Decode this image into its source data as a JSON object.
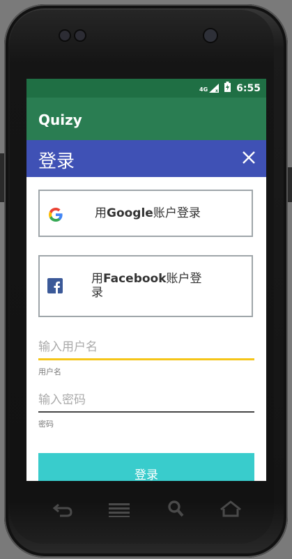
{
  "status": {
    "network": "4G",
    "time": "6:55"
  },
  "app": {
    "title": "Quizy"
  },
  "dialog": {
    "title": "登录",
    "google_prefix": "用",
    "google_brand": "Google",
    "google_suffix": "账户登录",
    "facebook_prefix": "用",
    "facebook_brand": "Facebook",
    "facebook_suffix": "账户登录",
    "username_placeholder": "输入用户名",
    "username_helper": "用户名",
    "password_placeholder": "输入密码",
    "password_helper": "密码",
    "login_label": "登录"
  },
  "colors": {
    "statusbar": "#1f6f44",
    "appbar": "#2a7d52",
    "dialog_header": "#3f51b5",
    "accent": "#f5c518",
    "login_button": "#39cccc"
  },
  "nav_icons": [
    "back-icon",
    "menu-icon",
    "search-icon",
    "home-icon"
  ]
}
